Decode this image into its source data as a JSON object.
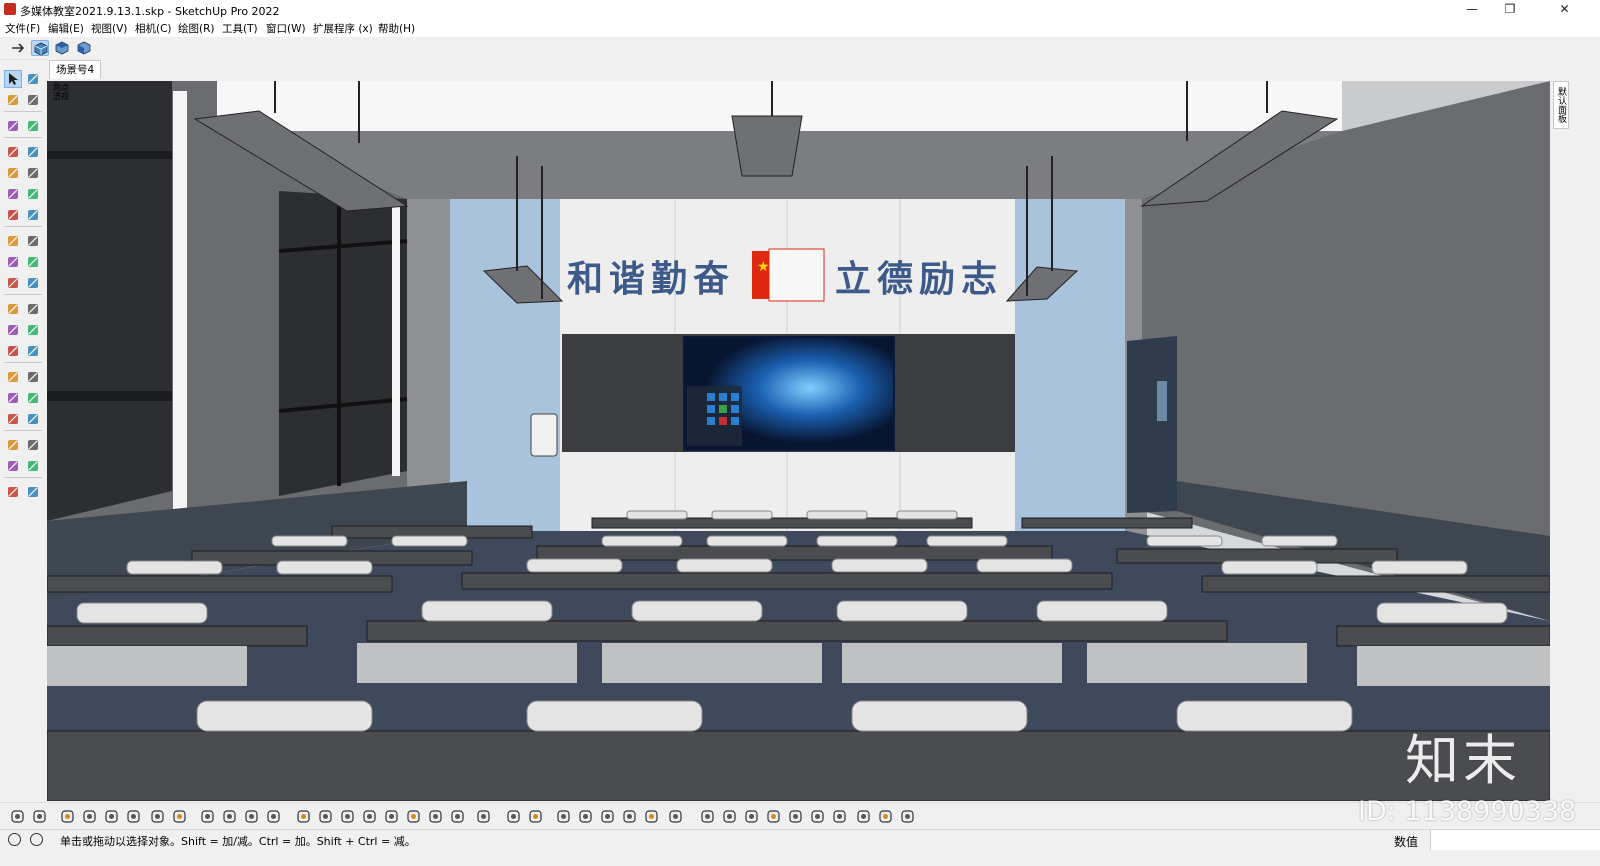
{
  "window": {
    "title": "多媒体教室2021.9.13.1.skp - SketchUp Pro 2022",
    "minimize": "—",
    "restore": "❐",
    "close": "✕"
  },
  "menu": {
    "file": "文件(F)",
    "edit": "编辑(E)",
    "view": "视图(V)",
    "camera": "相机(C)",
    "draw": "绘图(R)",
    "tools": "工具(T)",
    "window": "窗口(W)",
    "extensions": "扩展程序 (x)",
    "help": "帮助(H)"
  },
  "scene": {
    "tab_label": "场景号4"
  },
  "viewport": {
    "camera_label_line1": "两点",
    "camera_label_line2": "透视",
    "banner_left": "和谐勤奋",
    "banner_right": "立德励志"
  },
  "right_panel": {
    "tray_tab": "默认面板"
  },
  "status": {
    "hint": "单击或拖动以选择对象。Shift = 加/减。Ctrl = 加。Shift + Ctrl = 减。",
    "measurements_label": "数值",
    "measurements_value": ""
  },
  "watermark": {
    "logo": "知末",
    "id": "ID: 1138990338"
  },
  "colors": {
    "accent_selected": "#b9d6f3",
    "wall_blue": "#a9c3dc",
    "desk_dark": "#4a4c50",
    "chair_light": "#e4e4e4",
    "banner_text": "#3d5a8a",
    "flag_red": "#de2910"
  },
  "icons": {
    "toolbar_top": [
      "arrow-icon",
      "iso-view-icon",
      "top-view-icon",
      "front-view-icon"
    ],
    "left_tools": [
      "select-icon",
      "orbit-icon",
      "paint-bucket-icon",
      "eraser-icon",
      "component-icon",
      "tape-measure-icon",
      "line-icon",
      "freehand-icon",
      "rectangle-icon",
      "rotated-rectangle-icon",
      "circle-icon",
      "polygon-icon",
      "arc-icon",
      "pie-icon",
      "move-icon",
      "push-pull-icon",
      "rotate-icon",
      "follow-me-icon",
      "scale-icon",
      "offset-icon",
      "tape-icon",
      "dimension-icon",
      "protractor-icon",
      "text-icon",
      "axes-icon",
      "3d-text-icon",
      "orbit-tool-icon",
      "pan-icon",
      "zoom-icon",
      "zoom-window-icon",
      "zoom-extents-icon",
      "search-icon",
      "walk-icon",
      "look-around-icon",
      "footprint-icon",
      "position-camera-icon",
      "section-plane-icon",
      "section-display-icon"
    ]
  }
}
